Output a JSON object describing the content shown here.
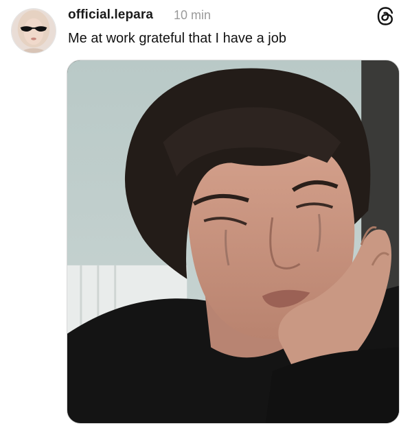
{
  "post": {
    "username": "official.lepara",
    "timestamp": "10 min",
    "caption": "Me at work grateful that I have a job"
  },
  "icons": {
    "app_logo": "threads-logo-icon",
    "avatar": "profile-avatar-sunglasses"
  },
  "colors": {
    "username": "#1a1a1a",
    "timestamp": "#9a9a9a",
    "caption": "#111111",
    "background": "#ffffff"
  }
}
